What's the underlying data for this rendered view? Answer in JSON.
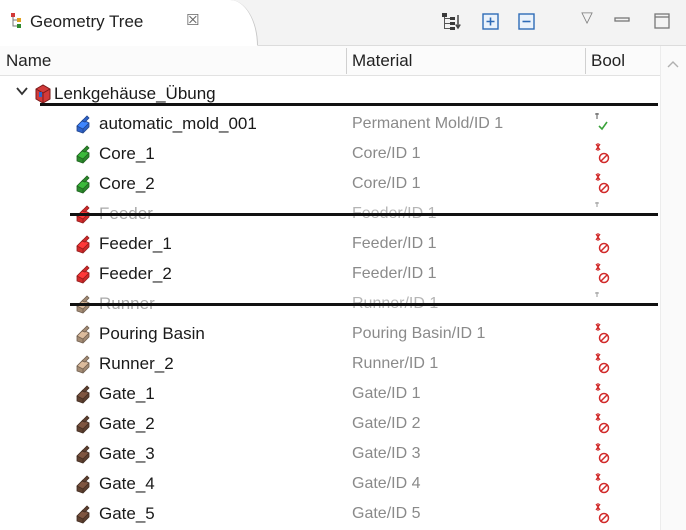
{
  "tab": {
    "title": "Geometry Tree",
    "close_glyph": "☒",
    "icon": "geometry-tree-icon"
  },
  "toolbar": {
    "buttons": [
      "link-with-editor-icon",
      "expand-all-icon",
      "collapse-all-icon"
    ],
    "view_menu_glyph": "▽",
    "minimize": "minimize-icon",
    "maximize": "maximize-icon"
  },
  "columns": {
    "name": "Name",
    "material": "Material",
    "bool": "Bool"
  },
  "colors": {
    "blue": "#2f63c9",
    "green": "#2c8a2c",
    "red": "#d12a2a",
    "tan": "#a38b74",
    "brown": "#5e4030",
    "check": "#3aa23a",
    "struck": "#111111"
  },
  "tree": {
    "root": {
      "name": "Lenkgehäuse_Übung",
      "expanded": true,
      "struck": true
    },
    "items": [
      {
        "name": "automatic_mold_001",
        "material": "Permanent Mold/ID 1",
        "color": "blue",
        "bool": "check",
        "disabled": false,
        "struck": false
      },
      {
        "name": "Core_1",
        "material": "Core/ID 1",
        "color": "green",
        "bool": "forbid",
        "disabled": false,
        "struck": false
      },
      {
        "name": "Core_2",
        "material": "Core/ID 1",
        "color": "green",
        "bool": "forbid",
        "disabled": false,
        "struck": false
      },
      {
        "name": "Feeder",
        "material": "Feeder/ID 1",
        "color": "red",
        "bool": "none",
        "disabled": true,
        "struck": true
      },
      {
        "name": "Feeder_1",
        "material": "Feeder/ID 1",
        "color": "red",
        "bool": "forbid",
        "disabled": false,
        "struck": false
      },
      {
        "name": "Feeder_2",
        "material": "Feeder/ID 1",
        "color": "red",
        "bool": "forbid",
        "disabled": false,
        "struck": false
      },
      {
        "name": "Runner",
        "material": "Runner/ID 1",
        "color": "tan",
        "bool": "none",
        "disabled": true,
        "struck": true
      },
      {
        "name": "Pouring Basin",
        "material": "Pouring Basin/ID 1",
        "color": "tan",
        "bool": "forbid",
        "disabled": false,
        "struck": false
      },
      {
        "name": "Runner_2",
        "material": "Runner/ID 1",
        "color": "tan",
        "bool": "forbid",
        "disabled": false,
        "struck": false
      },
      {
        "name": "Gate_1",
        "material": "Gate/ID 1",
        "color": "brown",
        "bool": "forbid",
        "disabled": false,
        "struck": false
      },
      {
        "name": "Gate_2",
        "material": "Gate/ID 2",
        "color": "brown",
        "bool": "forbid",
        "disabled": false,
        "struck": false
      },
      {
        "name": "Gate_3",
        "material": "Gate/ID 3",
        "color": "brown",
        "bool": "forbid",
        "disabled": false,
        "struck": false
      },
      {
        "name": "Gate_4",
        "material": "Gate/ID 4",
        "color": "brown",
        "bool": "forbid",
        "disabled": false,
        "struck": false
      },
      {
        "name": "Gate_5",
        "material": "Gate/ID 5",
        "color": "brown",
        "bool": "forbid",
        "disabled": false,
        "struck": false
      }
    ]
  }
}
